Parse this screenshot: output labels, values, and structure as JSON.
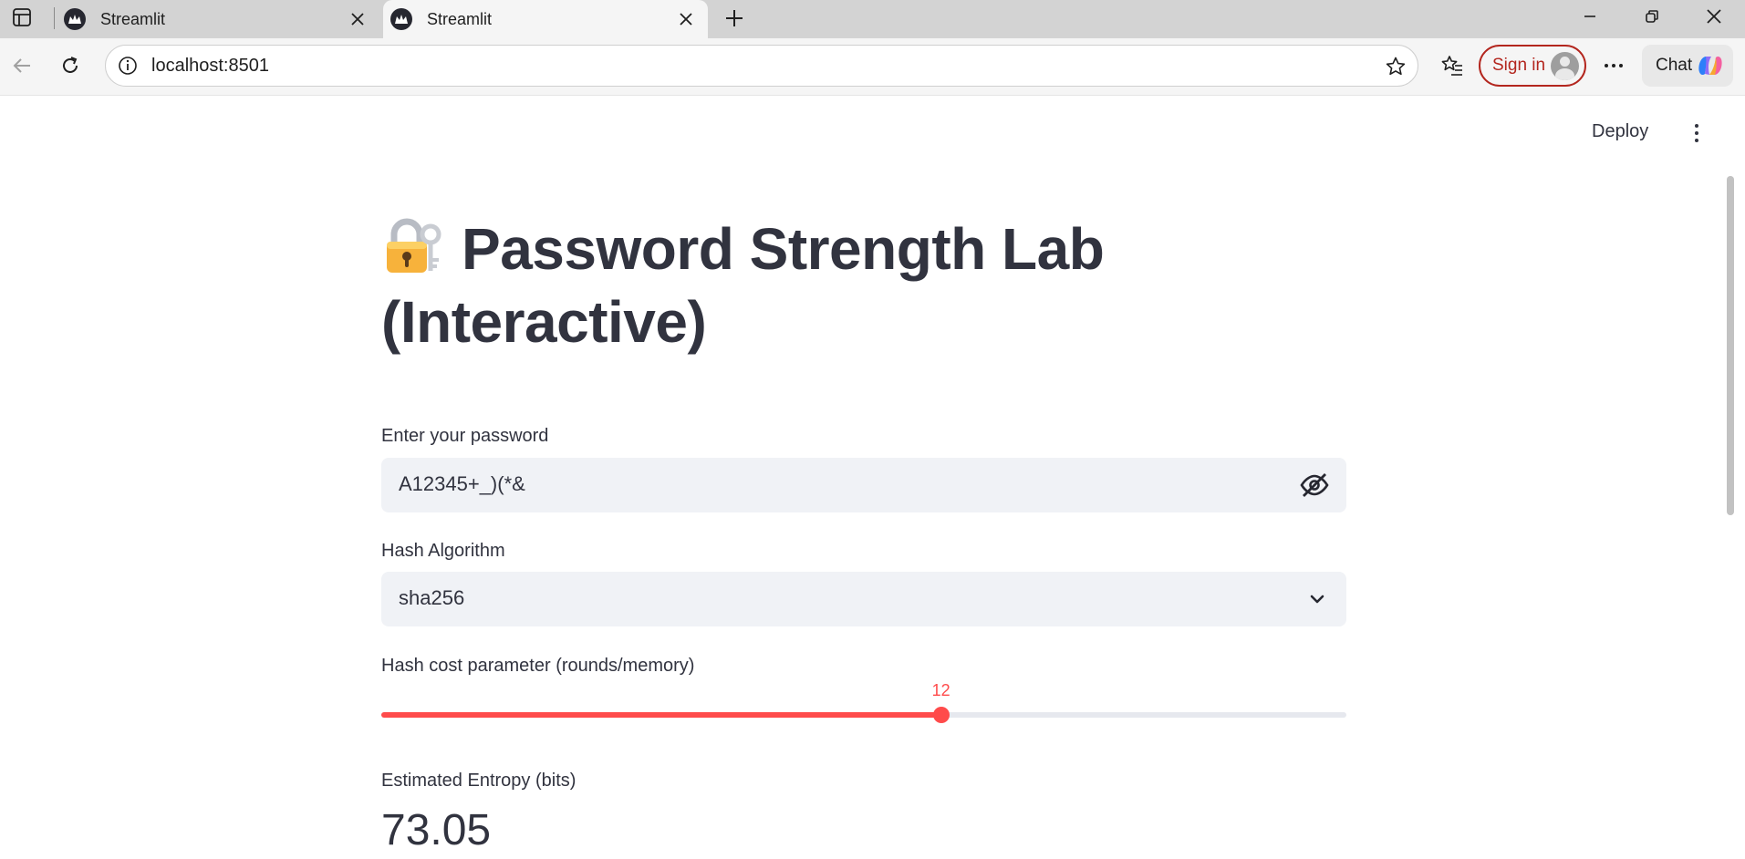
{
  "browser": {
    "tabs": [
      {
        "title": "Streamlit",
        "active": false
      },
      {
        "title": "Streamlit",
        "active": true
      }
    ],
    "url": "localhost:8501",
    "sign_in_label": "Sign in",
    "chat_label": "Chat"
  },
  "app": {
    "deploy_label": "Deploy",
    "title": "Password Strength Lab (Interactive)",
    "title_icon": "locked-with-key-icon",
    "password": {
      "label": "Enter your password",
      "value": "A12345+_)(*&"
    },
    "hash_algorithm": {
      "label": "Hash Algorithm",
      "selected": "sha256"
    },
    "hash_cost": {
      "label": "Hash cost parameter (rounds/memory)",
      "value": "12",
      "fraction": 0.58
    },
    "entropy": {
      "label": "Estimated Entropy (bits)",
      "value": "73.05"
    }
  },
  "colors": {
    "accent": "#ff4b4b",
    "text": "#31333f",
    "input_bg": "#f0f2f6",
    "sign_in": "#b3261e"
  }
}
